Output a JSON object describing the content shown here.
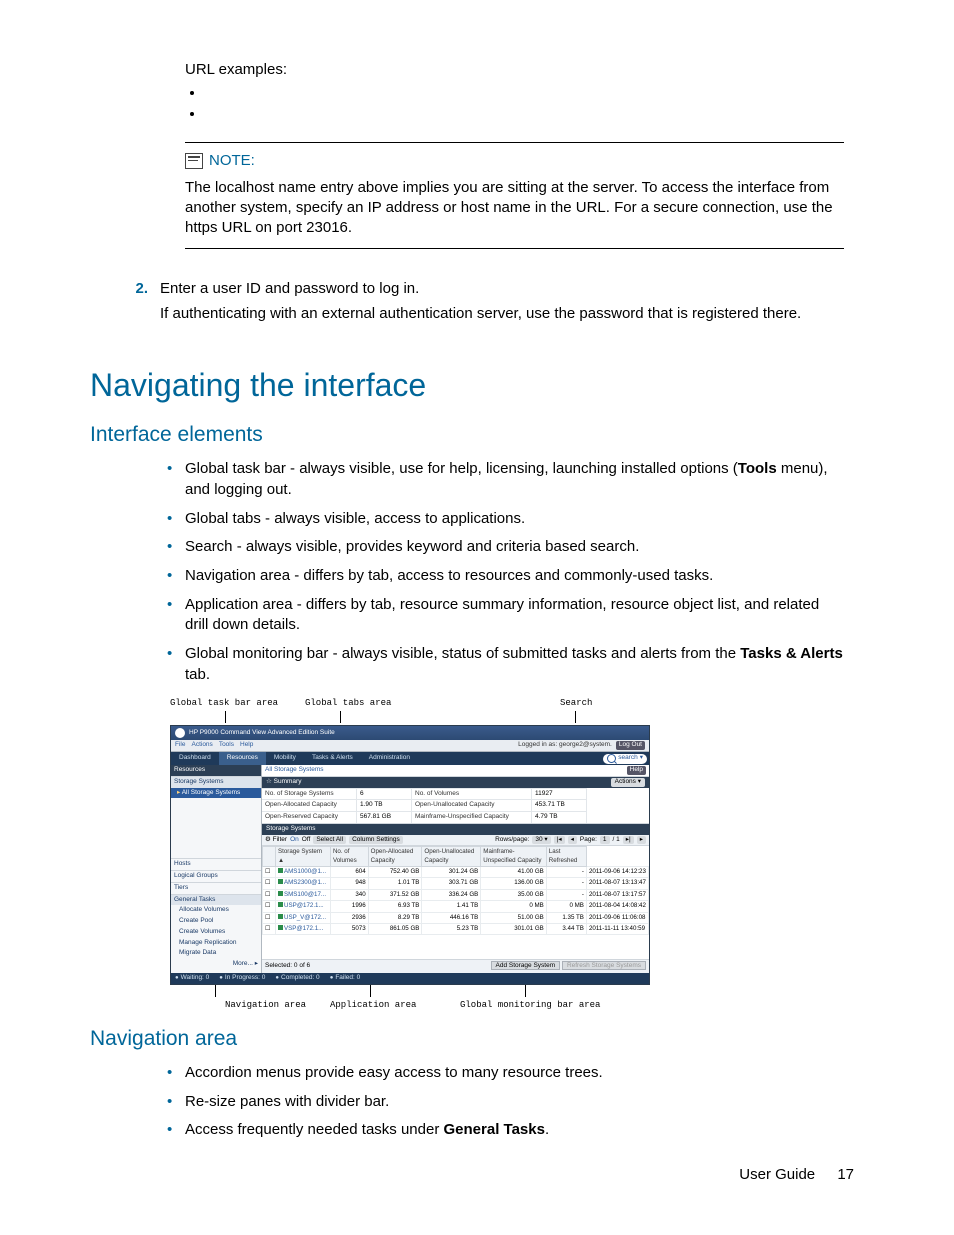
{
  "url_examples_label": "URL examples:",
  "note": {
    "label": "NOTE:",
    "body": "The localhost name entry above implies you are sitting at the server. To access the interface from another system, specify an IP address or host name in the URL. For a secure connection, use the https URL on port 23016."
  },
  "step2": {
    "num": "2.",
    "line1": "Enter a user ID and password to log in.",
    "line2": "If authenticating with an external authentication server, use the password that is registered there."
  },
  "heading": "Navigating the interface",
  "subheading_elements": "Interface elements",
  "elements_list": [
    {
      "pre": "Global task bar - always visible, use for help, licensing, launching installed options (",
      "b": "Tools",
      "post": " menu), and logging out."
    },
    {
      "pre": "Global tabs - always visible, access to applications.",
      "b": "",
      "post": ""
    },
    {
      "pre": "Search - always visible, provides keyword and criteria based search.",
      "b": "",
      "post": ""
    },
    {
      "pre": "Navigation area - differs by tab, access to resources and commonly-used tasks.",
      "b": "",
      "post": ""
    },
    {
      "pre": "Application area - differs by tab, resource summary information, resource object list, and related drill down details.",
      "b": "",
      "post": ""
    },
    {
      "pre": "Global monitoring bar - always visible, status of submitted tasks and alerts from the ",
      "b": "Tasks & Alerts",
      "post": " tab."
    }
  ],
  "shot_top_labels": {
    "task": "Global task bar area",
    "tabs": "Global tabs area",
    "search": "Search"
  },
  "shot": {
    "title": "HP P9000 Command View Advanced Edition Suite",
    "menu": {
      "file": "File",
      "actions": "Actions",
      "tools": "Tools",
      "help": "Help"
    },
    "logged_in": "Logged in as: george2@system.",
    "logout": "Log Out",
    "tabs": [
      "Dashboard",
      "Resources",
      "Mobility",
      "Tasks & Alerts",
      "Administration"
    ],
    "active_tab": 1,
    "search_text": "search",
    "nav": {
      "hdr": "Resources",
      "storage_section": "Storage Systems",
      "sel": "All Storage Systems",
      "groups": [
        "Hosts",
        "Logical Groups",
        "Tiers",
        "General Tasks"
      ],
      "tasks": [
        "Allocate Volumes",
        "Create Pool",
        "Create Volumes",
        "Manage Replication",
        "Migrate Data"
      ],
      "more": "More... ▸"
    },
    "app": {
      "breadcrumb": "All Storage Systems",
      "help": "Help",
      "summary_title": "Summary",
      "actions": "Actions   ▾",
      "summary": [
        [
          "No. of Storage Systems",
          "6",
          "No. of Volumes",
          "11927"
        ],
        [
          "Open-Allocated Capacity",
          "1.90 TB",
          "Open-Unallocated Capacity",
          "453.71 TB"
        ],
        [
          "Open-Reserved Capacity",
          "567.81 GB",
          "Mainframe-Unspecified Capacity",
          "4.79 TB"
        ]
      ],
      "systems_title": "Storage Systems",
      "toolbar": {
        "filter": "Filter",
        "on": "On",
        "off": "Off",
        "select_all": "Select All",
        "column_settings": "Column Settings",
        "rows": "Rows/page:",
        "rows_val": "30",
        "page": "Page:",
        "page_val": "1",
        "page_total": "/ 1"
      },
      "cols": [
        "Storage System ▲",
        "No. of Volumes",
        "Open-Allocated Capacity",
        "Open-Unallocated Capacity",
        "Mainframe-Unspecified Capacity",
        "Last Refreshed"
      ],
      "rows": [
        [
          "AMS1000@1...",
          "604",
          "752.40 GB",
          "301.24 GB",
          "41.00 GB",
          "-",
          "2011-09-06 14:12:23"
        ],
        [
          "AMS2300@1...",
          "948",
          "1.01 TB",
          "303.71 GB",
          "136.00 GB",
          "-",
          "2011-08-07 13:13:47"
        ],
        [
          "SMS100@17...",
          "340",
          "371.52 GB",
          "336.24 GB",
          "35.00 GB",
          "-",
          "2011-08-07 13:17:57"
        ],
        [
          "USP@172.1...",
          "1996",
          "6.93 TB",
          "1.41 TB",
          "0 MB",
          "0 MB",
          "2011-08-04 14:08:42"
        ],
        [
          "USP_V@172...",
          "2936",
          "8.29 TB",
          "446.16 TB",
          "51.00 GB",
          "1.35 TB",
          "2011-09-06 11:06:08"
        ],
        [
          "VSP@172.1...",
          "5073",
          "861.05 GB",
          "5.23 TB",
          "301.01 GB",
          "3.44 TB",
          "2011-11-11 13:40:59"
        ]
      ],
      "footer": {
        "sel": "Selected: 0 of 6",
        "add": "Add Storage System",
        "refresh": "Refresh Storage Systems"
      }
    },
    "monitor": [
      "Waiting: 0",
      "In Progress: 0",
      "Completed: 0",
      "Failed: 0"
    ]
  },
  "shot_bot_labels": {
    "nav": "Navigation area",
    "app": "Application area",
    "mon": "Global monitoring bar area"
  },
  "subheading_nav": "Navigation area",
  "nav_list": [
    {
      "pre": "Accordion menus provide easy access to many resource trees.",
      "b": "",
      "post": ""
    },
    {
      "pre": "Re-size panes with divider bar.",
      "b": "",
      "post": ""
    },
    {
      "pre": "Access frequently needed tasks under ",
      "b": "General Tasks",
      "post": "."
    }
  ],
  "footer": {
    "label": "User Guide",
    "page": "17"
  }
}
